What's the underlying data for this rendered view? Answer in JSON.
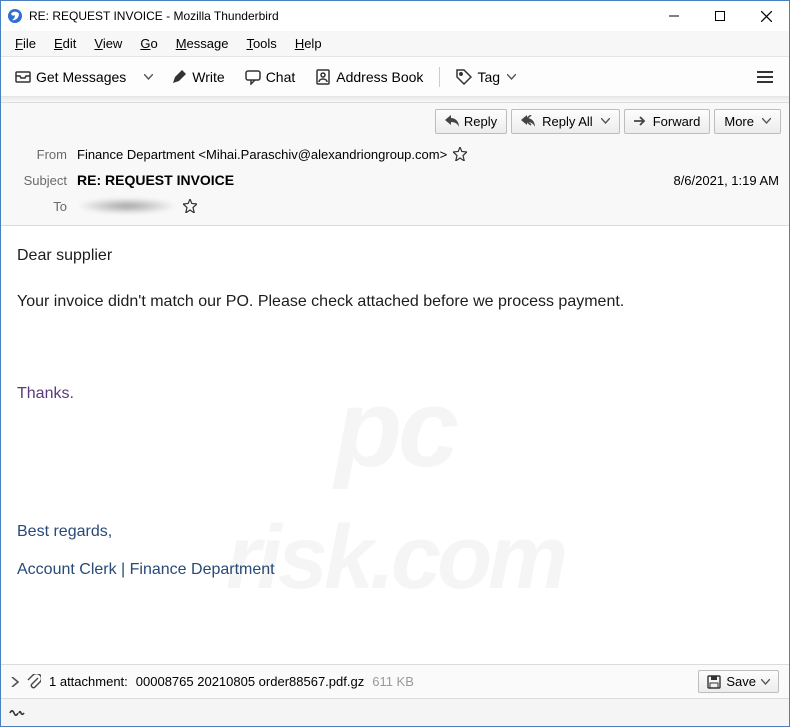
{
  "window": {
    "title": "RE: REQUEST INVOICE - Mozilla Thunderbird"
  },
  "menu": {
    "file": "File",
    "edit": "Edit",
    "view": "View",
    "go": "Go",
    "message": "Message",
    "tools": "Tools",
    "help": "Help"
  },
  "toolbar": {
    "get_messages": "Get Messages",
    "write": "Write",
    "chat": "Chat",
    "address_book": "Address Book",
    "tag": "Tag"
  },
  "actions": {
    "reply": "Reply",
    "reply_all": "Reply All",
    "forward": "Forward",
    "more": "More"
  },
  "headers": {
    "from_label": "From",
    "from_value": "Finance Department <Mihai.Paraschiv@alexandriongroup.com>",
    "subject_label": "Subject",
    "subject_value": "RE: REQUEST INVOICE",
    "date_value": "8/6/2021, 1:19 AM",
    "to_label": "To"
  },
  "body": {
    "greeting": "Dear supplier",
    "line1": "Your invoice didn't match our PO. Please check attached before we process payment.",
    "thanks": "Thanks.",
    "regards": "Best regards,",
    "signature": "Account Clerk | Finance Department"
  },
  "attachment": {
    "label_prefix": "1 attachment:",
    "filename": "00008765 20210805 order88567.pdf.gz",
    "size": "611 KB",
    "save": "Save"
  },
  "watermark": {
    "line1": "pc",
    "line2": "risk.com"
  }
}
